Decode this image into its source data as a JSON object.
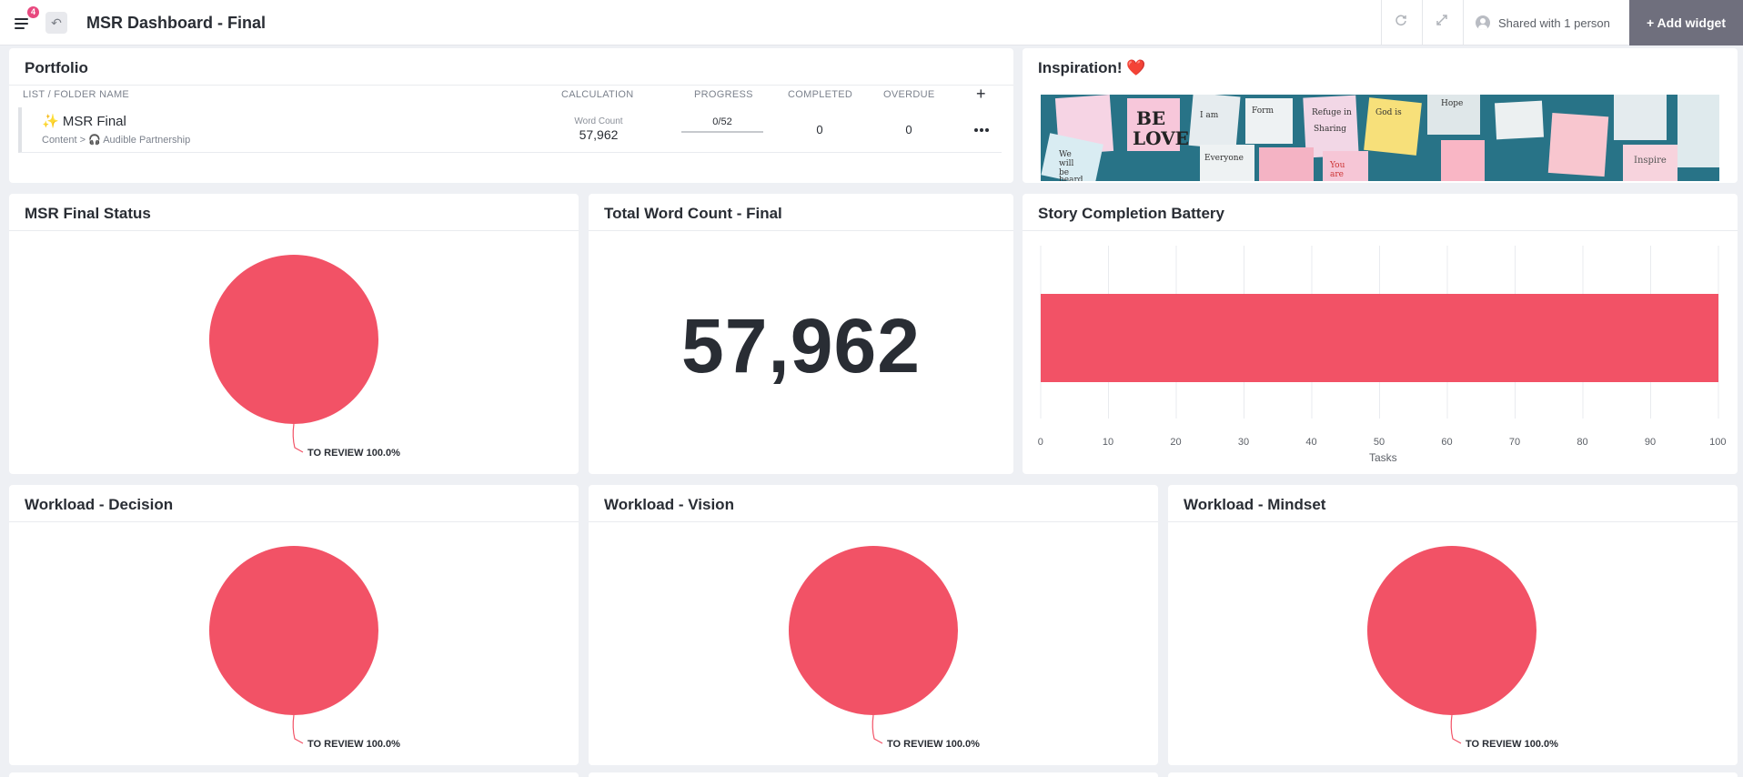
{
  "header": {
    "title": "MSR Dashboard - Final",
    "notification_count": "4",
    "shared_label": "Shared with 1 person",
    "add_widget_label": "+ Add widget"
  },
  "portfolio": {
    "title": "Portfolio",
    "columns": {
      "name": "LIST / FOLDER NAME",
      "calculation": "CALCULATION",
      "progress": "PROGRESS",
      "completed": "COMPLETED",
      "overdue": "OVERDUE"
    },
    "add_symbol": "+",
    "rows": [
      {
        "name": "✨ MSR Final",
        "path": "Content > 🎧 Audible Partnership",
        "calc_label": "Word Count",
        "calc_value": "57,962",
        "progress": "0/52",
        "completed": "0",
        "overdue": "0"
      }
    ]
  },
  "inspiration": {
    "title": "Inspiration! ❤️",
    "notes": [
      "BE",
      "LOVE",
      "I am",
      "Form",
      "Refuge in",
      "Sharing",
      "God is",
      "Hope",
      "We",
      "will",
      "be",
      "heard",
      "Everyone",
      "You",
      "are",
      "Inspire"
    ]
  },
  "msr_final_status": {
    "title": "MSR Final Status",
    "slice_label": "TO REVIEW 100.0%"
  },
  "total_word_count": {
    "title": "Total Word Count - Final",
    "value": "57,962"
  },
  "battery": {
    "title": "Story Completion Battery",
    "axis_label": "Tasks",
    "ticks": [
      "0",
      "10",
      "20",
      "30",
      "40",
      "50",
      "60",
      "70",
      "80",
      "90",
      "100"
    ]
  },
  "workload_decision": {
    "title": "Workload - Decision",
    "slice_label": "TO REVIEW 100.0%"
  },
  "workload_vision": {
    "title": "Workload - Vision",
    "slice_label": "TO REVIEW 100.0%"
  },
  "workload_mindset": {
    "title": "Workload - Mindset",
    "slice_label": "TO REVIEW 100.0%"
  },
  "colors": {
    "accent": "#f25266",
    "header_button": "#6f6f7d",
    "notification": "#e8497f"
  },
  "icons": {
    "menu": "menu-icon",
    "back": "back-arrow-icon",
    "refresh": "refresh-icon",
    "expand": "expand-icon",
    "user": "user-icon",
    "more": "more-dots-icon"
  },
  "chart_data": [
    {
      "type": "pie",
      "title": "MSR Final Status",
      "slices": [
        {
          "label": "TO REVIEW",
          "value": 100.0
        }
      ]
    },
    {
      "type": "bar",
      "title": "Story Completion Battery",
      "orientation": "horizontal",
      "xlabel": "Tasks",
      "xlim": [
        0,
        100
      ],
      "values": [
        100
      ],
      "grid": true
    },
    {
      "type": "pie",
      "title": "Workload - Decision",
      "slices": [
        {
          "label": "TO REVIEW",
          "value": 100.0
        }
      ]
    },
    {
      "type": "pie",
      "title": "Workload - Vision",
      "slices": [
        {
          "label": "TO REVIEW",
          "value": 100.0
        }
      ]
    },
    {
      "type": "pie",
      "title": "Workload - Mindset",
      "slices": [
        {
          "label": "TO REVIEW",
          "value": 100.0
        }
      ]
    }
  ]
}
